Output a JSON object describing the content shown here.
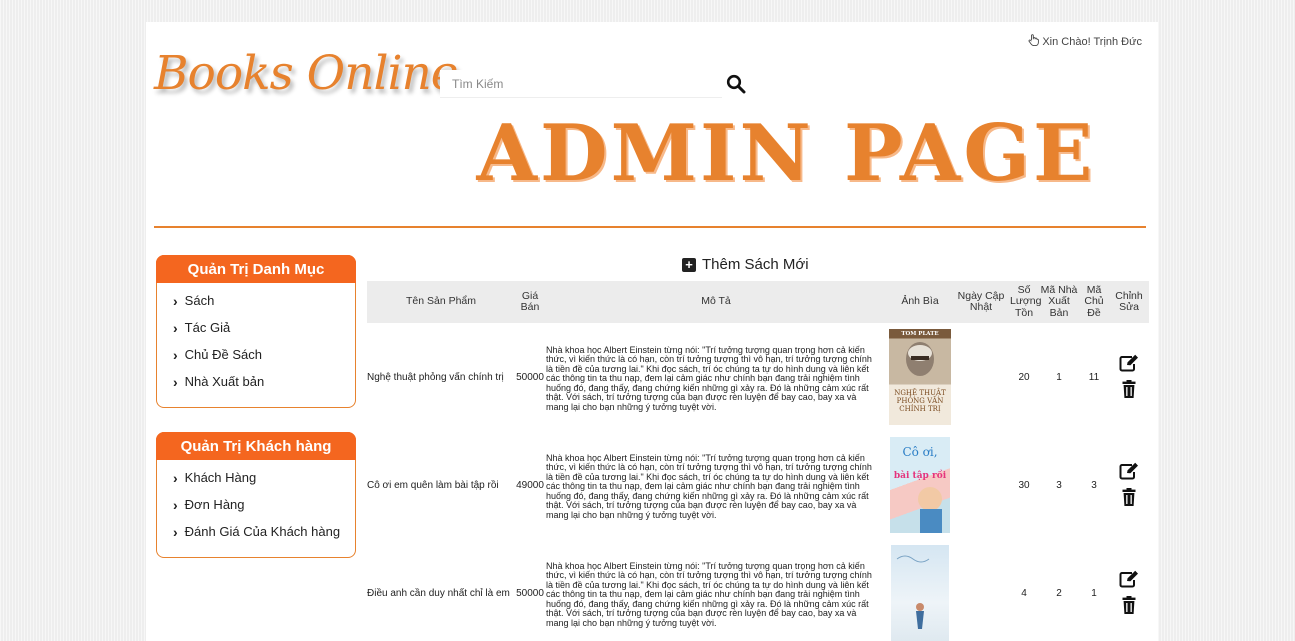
{
  "brand": {
    "logo_text": "Books Online"
  },
  "search": {
    "placeholder": "Tìm Kiếm"
  },
  "header": {
    "greeting": "Xin Chào! Trịnh Đức",
    "banner": "ADMIN PAGE"
  },
  "colors": {
    "accent": "#e7822e",
    "panel_header": "#f4661f"
  },
  "sidebar": {
    "catalog": {
      "title": "Quản Trị Danh Mục",
      "items": [
        {
          "label": "Sách"
        },
        {
          "label": "Tác Giả"
        },
        {
          "label": "Chủ Đề Sách"
        },
        {
          "label": "Nhà Xuất bản"
        }
      ]
    },
    "customers": {
      "title": "Quản Trị Khách hàng",
      "items": [
        {
          "label": "Khách Hàng"
        },
        {
          "label": "Đơn Hàng"
        },
        {
          "label": "Đánh Giá Của Khách hàng"
        }
      ]
    }
  },
  "main": {
    "add_label": "Thêm Sách Mới",
    "columns": {
      "name": "Tên Sản Phẩm",
      "price": "Giá Bán",
      "desc": "Mô Tả",
      "cover": "Ảnh Bìa",
      "updated": "Ngày Cập Nhật",
      "stock": "Số Lượng Tồn",
      "publisher": "Mã Nhà Xuất Bản",
      "topic": "Mã Chủ Đề",
      "edit": "Chỉnh Sửa"
    },
    "rows": [
      {
        "name": "Nghệ thuật phỏng vấn chính trị",
        "price": "50000",
        "desc": "Nhà khoa học Albert Einstein từng nói: \"Trí tưởng tượng quan trọng hơn cả kiến thức, vì kiến thức là có hạn, còn trí tưởng tượng thì vô hạn, trí tưởng tượng chính là tiền đề của tương lai.\" Khi đọc sách, trí óc chúng ta tự do hình dung và liên kết các thông tin ta thu nạp, đem lại cảm giác như chính bạn đang trải nghiệm tình huống đó, đang thấy, đang chứng kiến những gì xảy ra. Đó là những cảm xúc rất thật. Với sách, trí tưởng tượng của bạn được rèn luyện để bay cao, bay xa và mang lại cho bạn những ý tưởng tuyệt vời.",
        "cover": {
          "top": "TOM PLATE",
          "title": "NGHỆ THUẬT PHỎNG VẤN CHÍNH TRỊ"
        },
        "updated": "",
        "stock": "20",
        "publisher": "1",
        "topic": "11"
      },
      {
        "name": "Cô ơi em quên làm bài tập rồi",
        "price": "49000",
        "desc": "Nhà khoa học Albert Einstein từng nói: \"Trí tưởng tượng quan trọng hơn cả kiến thức, vì kiến thức là có hạn, còn trí tưởng tượng thì vô hạn, trí tưởng tượng chính là tiền đề của tương lai.\" Khi đọc sách, trí óc chúng ta tự do hình dung và liên kết các thông tin ta thu nạp, đem lại cảm giác như chính bạn đang trải nghiệm tình huống đó, đang thấy, đang chứng kiến những gì xảy ra. Đó là những cảm xúc rất thật. Với sách, trí tưởng tượng của bạn được rèn luyện để bay cao, bay xa và mang lại cho bạn những ý tưởng tuyệt vời.",
        "cover": {
          "top": "Cô ơi,",
          "title": "bài tập rồi"
        },
        "updated": "",
        "stock": "30",
        "publisher": "3",
        "topic": "3"
      },
      {
        "name": "Điều anh cần duy nhất chỉ là em",
        "price": "50000",
        "desc": "Nhà khoa học Albert Einstein từng nói: \"Trí tưởng tượng quan trọng hơn cả kiến thức, vì kiến thức là có hạn, còn trí tưởng tượng thì vô hạn, trí tưởng tượng chính là tiền đề của tương lai.\" Khi đọc sách, trí óc chúng ta tự do hình dung và liên kết các thông tin ta thu nạp, đem lại cảm giác như chính bạn đang trải nghiệm tình huống đó, đang thấy, đang chứng kiến những gì xảy ra. Đó là những cảm xúc rất thật. Với sách, trí tưởng tượng của bạn được rèn luyện để bay cao, bay xa và mang lại cho bạn những ý tưởng tuyệt vời.",
        "cover": {
          "top": "",
          "title": ""
        },
        "updated": "",
        "stock": "4",
        "publisher": "2",
        "topic": "1"
      }
    ]
  }
}
